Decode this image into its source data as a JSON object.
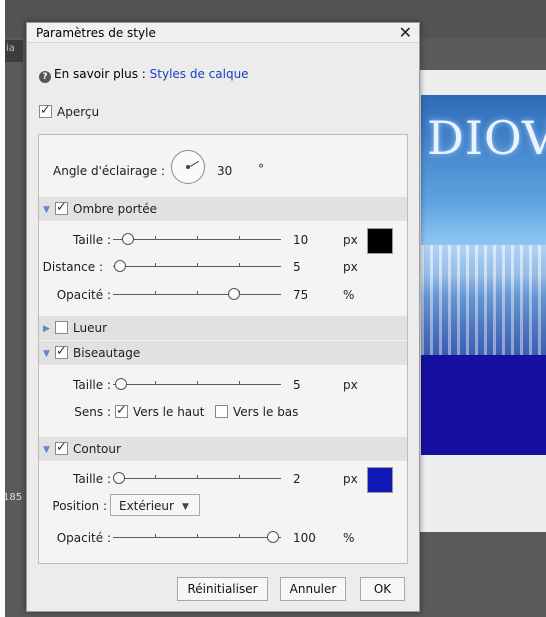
{
  "dialog": {
    "title": "Paramètres de style",
    "help_prefix": "En savoir plus :",
    "help_link": "Styles de calque",
    "preview_label": "Aperçu"
  },
  "lighting": {
    "label": "Angle d'éclairage :",
    "value": "30",
    "unit": "°"
  },
  "drop_shadow": {
    "title": "Ombre portée",
    "size_label": "Taille :",
    "size_value": "10",
    "size_unit": "px",
    "distance_label": "Distance :",
    "distance_value": "5",
    "distance_unit": "px",
    "opacity_label": "Opacité :",
    "opacity_value": "75",
    "opacity_unit": "%",
    "color": "#000000"
  },
  "glow": {
    "title": "Lueur"
  },
  "bevel": {
    "title": "Biseautage",
    "size_label": "Taille :",
    "size_value": "5",
    "size_unit": "px",
    "direction_label": "Sens :",
    "up_label": "Vers le haut",
    "down_label": "Vers le bas"
  },
  "stroke": {
    "title": "Contour",
    "size_label": "Taille :",
    "size_value": "2",
    "size_unit": "px",
    "color": "#1218b4",
    "position_label": "Position :",
    "position_value": "Extérieur",
    "opacity_label": "Opacité :",
    "opacity_value": "100",
    "opacity_unit": "%"
  },
  "buttons": {
    "reset": "Réinitialiser",
    "cancel": "Annuler",
    "ok": "OK"
  },
  "background": {
    "canvas_text": "DIOV",
    "tab_text": "ia",
    "side_number": "185"
  }
}
